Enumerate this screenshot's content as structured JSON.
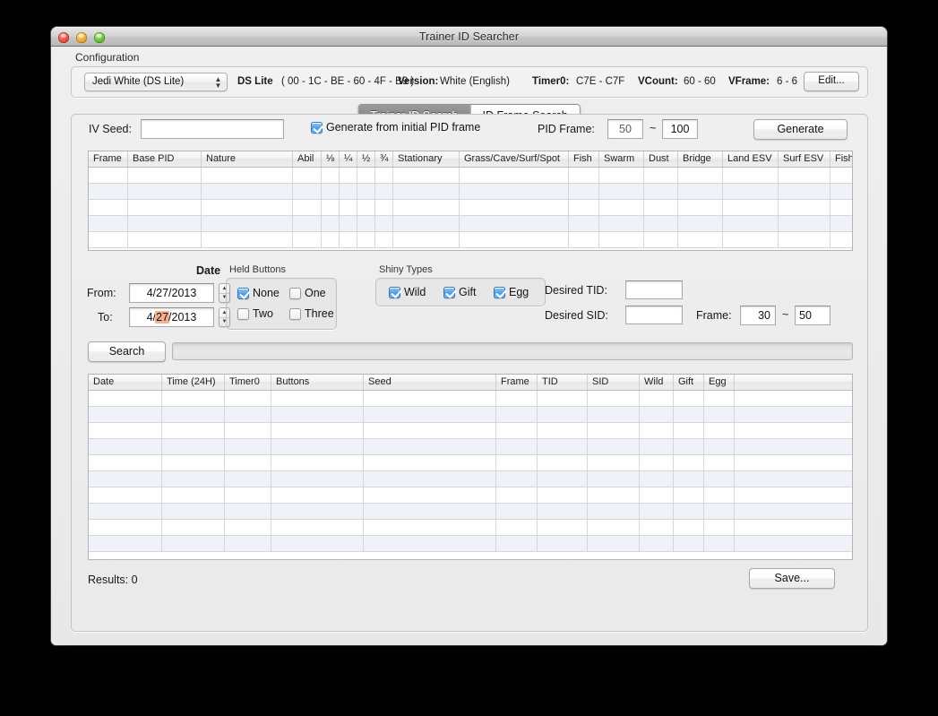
{
  "window": {
    "title": "Trainer ID Searcher",
    "traffic_lights": [
      "close-button",
      "minimize-button",
      "zoom-button"
    ]
  },
  "configuration": {
    "group_label": "Configuration",
    "profile_select": {
      "value": "Jedi White (DS Lite)",
      "options": [
        "Jedi White (DS Lite)"
      ]
    },
    "console_type": "DS Lite",
    "mac_address": "( 00 - 1C - BE - 60 - 4F - B9 )",
    "version_label": "Version:",
    "version_value": "White (English)",
    "timer0_label": "Timer0:",
    "timer0_value": "C7E - C7F",
    "vcount_label": "VCount:",
    "vcount_value": "60 - 60",
    "vframe_label": "VFrame:",
    "vframe_value": "6 - 6",
    "edit_button": "Edit..."
  },
  "tabs": [
    {
      "label": "Trainer ID Search",
      "active": true
    },
    {
      "label": "ID Frame Search",
      "active": false
    }
  ],
  "seed_row": {
    "iv_seed_label": "IV Seed:",
    "iv_seed_value": "",
    "generate_from_initial_pid_frame_label": "Generate from initial PID frame",
    "generate_from_initial_pid_frame_checked": true,
    "pid_frame_label": "PID Frame:",
    "pid_frame_min": "50",
    "pid_frame_tilde": "~",
    "pid_frame_max": "100",
    "generate_button": "Generate"
  },
  "frame_table": {
    "columns": [
      {
        "label": "Frame",
        "width": 44
      },
      {
        "label": "Base PID",
        "width": 82
      },
      {
        "label": "Nature",
        "width": 102
      },
      {
        "label": "Abil",
        "width": 32
      },
      {
        "label": "⅛",
        "width": 20
      },
      {
        "label": "¼",
        "width": 20
      },
      {
        "label": "½",
        "width": 20
      },
      {
        "label": "¾",
        "width": 20
      },
      {
        "label": "Stationary",
        "width": 74
      },
      {
        "label": "Grass/Cave/Surf/Spot",
        "width": 122
      },
      {
        "label": "Fish",
        "width": 34
      },
      {
        "label": "Swarm",
        "width": 50
      },
      {
        "label": "Dust",
        "width": 38
      },
      {
        "label": "Bridge",
        "width": 50
      },
      {
        "label": "Land ESV",
        "width": 62
      },
      {
        "label": "Surf ESV",
        "width": 58
      },
      {
        "label": "Fish ESV",
        "width": 58
      },
      {
        "label": "",
        "width": 24
      }
    ],
    "rows": [],
    "empty_row_count": 5
  },
  "date_group": {
    "title": "Date",
    "from_label": "From:",
    "from_value": "4/27/2013",
    "to_label": "To:",
    "to_value_pre": "4/",
    "to_value_selected": "27",
    "to_value_post": "/2013"
  },
  "held_buttons": {
    "title": "Held Buttons",
    "options": [
      {
        "label": "None",
        "checked": true
      },
      {
        "label": "One",
        "checked": false
      },
      {
        "label": "Two",
        "checked": false
      },
      {
        "label": "Three",
        "checked": false
      }
    ]
  },
  "shiny_types": {
    "title": "Shiny Types",
    "options": [
      {
        "label": "Wild",
        "checked": true
      },
      {
        "label": "Gift",
        "checked": true
      },
      {
        "label": "Egg",
        "checked": true
      }
    ]
  },
  "desired": {
    "tid_label": "Desired TID:",
    "tid_value": "",
    "sid_label": "Desired SID:",
    "sid_value": "",
    "frame_label": "Frame:",
    "frame_min": "30",
    "frame_tilde": "~",
    "frame_max": "50"
  },
  "search_row": {
    "search_button": "Search",
    "progress_percent": 0
  },
  "results_table": {
    "columns": [
      {
        "label": "Date",
        "width": 82
      },
      {
        "label": "Time (24H)",
        "width": 70
      },
      {
        "label": "Timer0",
        "width": 52
      },
      {
        "label": "Buttons",
        "width": 103
      },
      {
        "label": "Seed",
        "width": 148
      },
      {
        "label": "Frame",
        "width": 46
      },
      {
        "label": "TID",
        "width": 56
      },
      {
        "label": "SID",
        "width": 58
      },
      {
        "label": "Wild",
        "width": 38
      },
      {
        "label": "Gift",
        "width": 34
      },
      {
        "label": "Egg",
        "width": 34
      },
      {
        "label": "",
        "width": 132
      }
    ],
    "rows": [],
    "empty_row_count": 10
  },
  "footer": {
    "results_label": "Results: 0",
    "save_button": "Save..."
  }
}
